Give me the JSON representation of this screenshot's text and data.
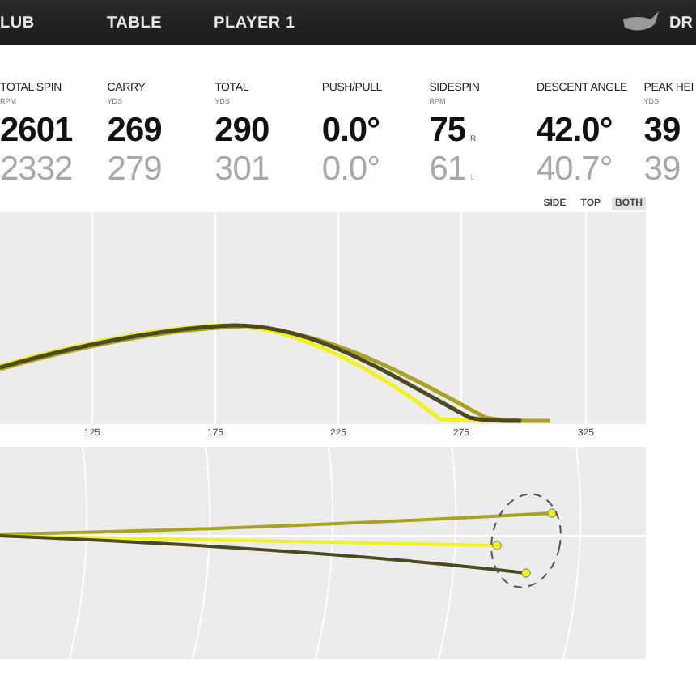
{
  "nav": {
    "tabs": [
      {
        "label": "LUB",
        "selected": false
      },
      {
        "label": "TABLE",
        "selected": false
      },
      {
        "label": "PLAYER 1",
        "selected": false
      }
    ],
    "club": "DR"
  },
  "stats": [
    {
      "label": "TOTAL SPIN",
      "unit": "RPM",
      "current": "2601",
      "previous": "2332"
    },
    {
      "label": "CARRY",
      "unit": "YDS",
      "current": "269",
      "previous": "279"
    },
    {
      "label": "TOTAL",
      "unit": "YDS",
      "current": "290",
      "previous": "301"
    },
    {
      "label": "PUSH/PULL",
      "current": "0.0°",
      "previous": "0.0°"
    },
    {
      "label": "SIDESPIN",
      "unit": "RPM",
      "current": "75",
      "current_suffix": "R",
      "previous": "61",
      "previous_suffix": "L"
    },
    {
      "label": "DESCENT ANGLE",
      "current": "42.0°",
      "previous": "40.7°"
    },
    {
      "label": "PEAK HEI",
      "unit": "YDS",
      "current": "39",
      "previous": "39"
    }
  ],
  "views": [
    {
      "label": "SIDE",
      "selected": false
    },
    {
      "label": "TOP",
      "selected": false
    },
    {
      "label": "BOTH",
      "selected": true
    }
  ],
  "distance_ticks": [
    "125",
    "175",
    "225",
    "275",
    "325"
  ],
  "shots": [
    {
      "color": "#a9a222"
    },
    {
      "color": "#f2f21e"
    },
    {
      "color": "#4b4a1e"
    }
  ]
}
